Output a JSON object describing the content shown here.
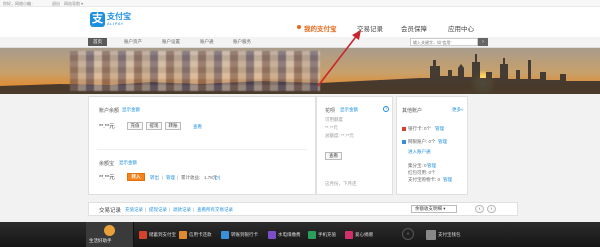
{
  "topbar": {
    "links": [
      "你好，网络小编 ·",
      "退出",
      "网站导航 ▾"
    ]
  },
  "logo": {
    "mark": "支",
    "cn": "支付宝",
    "en": "ALIPAY"
  },
  "main_nav": [
    "我的支付宝",
    "交易记录",
    "会员保障",
    "应用中心"
  ],
  "sub_nav": {
    "items": [
      "首页",
      "账户资产",
      "账户设置",
      "账户通",
      "账户服务"
    ],
    "search_placeholder": "输入关键字，如\"信用\"",
    "search_button": "›"
  },
  "balance_panel": {
    "title": "账户余额",
    "show_amount": "显示金额",
    "amount": "**.**元",
    "buttons": [
      "充值",
      "提现",
      "转账"
    ],
    "view_link": "查看"
  },
  "yuebao_panel": {
    "title": "余额宝",
    "show_amount": "显示金额",
    "amount": "**.**元",
    "transfer_in": "转入",
    "transfer_out": "转出",
    "manage": "管理",
    "earnings_label": "累计收益: ",
    "earnings_value": "1.78元",
    "earnings_note": "[?]"
  },
  "huabei_panel": {
    "title": "花呗",
    "show_amount": "显示金额",
    "help": "?",
    "lines": [
      "可用额度",
      "**.**元",
      "总额度: **.**元"
    ],
    "view_button": "查看",
    "footer": "这月份，下月还"
  },
  "other_accounts": {
    "title": "其他账户",
    "more": "更多»",
    "rows": [
      {
        "label": "银行卡: 0个",
        "link": "管理"
      },
      {
        "label": "网银账户: 0个",
        "link": "管理"
      },
      {
        "label": "进入账户通",
        "link": ""
      },
      {
        "label": "集分宝: 0",
        "link": "管理"
      },
      {
        "label": "红包可用: 0个",
        "link": ""
      },
      {
        "label": "支付宝购物卡: 0",
        "link": "管理"
      }
    ]
  },
  "trade_bar": {
    "title": "交易记录",
    "links": [
      "充值记录",
      "提现记录",
      "退款记录",
      "查看所有交易记录"
    ],
    "filter": "余额收支明细 ▾",
    "nav": [
      "‹",
      "›"
    ]
  },
  "toolbar": {
    "main": "生活好助手",
    "items": [
      "储蓄到支付宝",
      "信用卡还款",
      "转账到银行卡",
      "水电煤缴费",
      "手机充值",
      "爱心捐赠",
      "支付宝钱包"
    ],
    "more": "^",
    "colors": [
      "#d5422b",
      "#e08a2e",
      "#3a8fd8",
      "#7a4fc7",
      "#2a9f5a",
      "#d22f6d",
      "#888888"
    ]
  }
}
